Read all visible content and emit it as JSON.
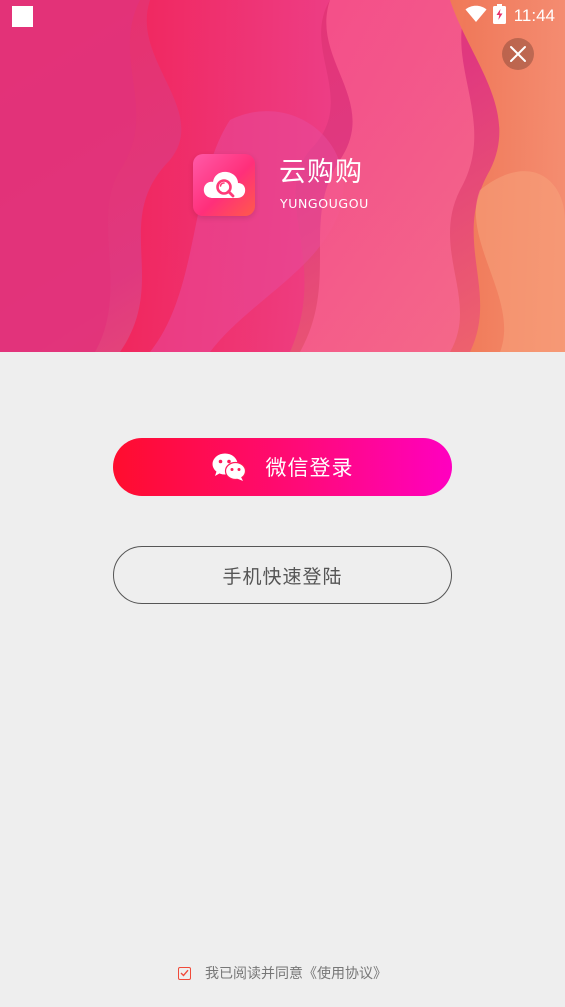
{
  "status_bar": {
    "time": "11:44",
    "icons": [
      "notification-square-icon",
      "wifi-icon",
      "battery-charging-icon"
    ]
  },
  "header": {
    "close_icon": "close-icon",
    "app_name": "云购购",
    "app_name_en": "YUNGOUGOU",
    "logo_icon": "cloud-search-icon"
  },
  "login": {
    "wechat_label": "微信登录",
    "wechat_icon": "wechat-icon",
    "phone_label": "手机快速登陆"
  },
  "agreement": {
    "checked": true,
    "text": "我已阅读并同意《使用协议》"
  },
  "colors": {
    "wechat_gradient_start": "#ff0d2e",
    "wechat_gradient_end": "#ff00c0",
    "background": "#eeeeee",
    "checkbox_accent": "#f04a3a"
  }
}
